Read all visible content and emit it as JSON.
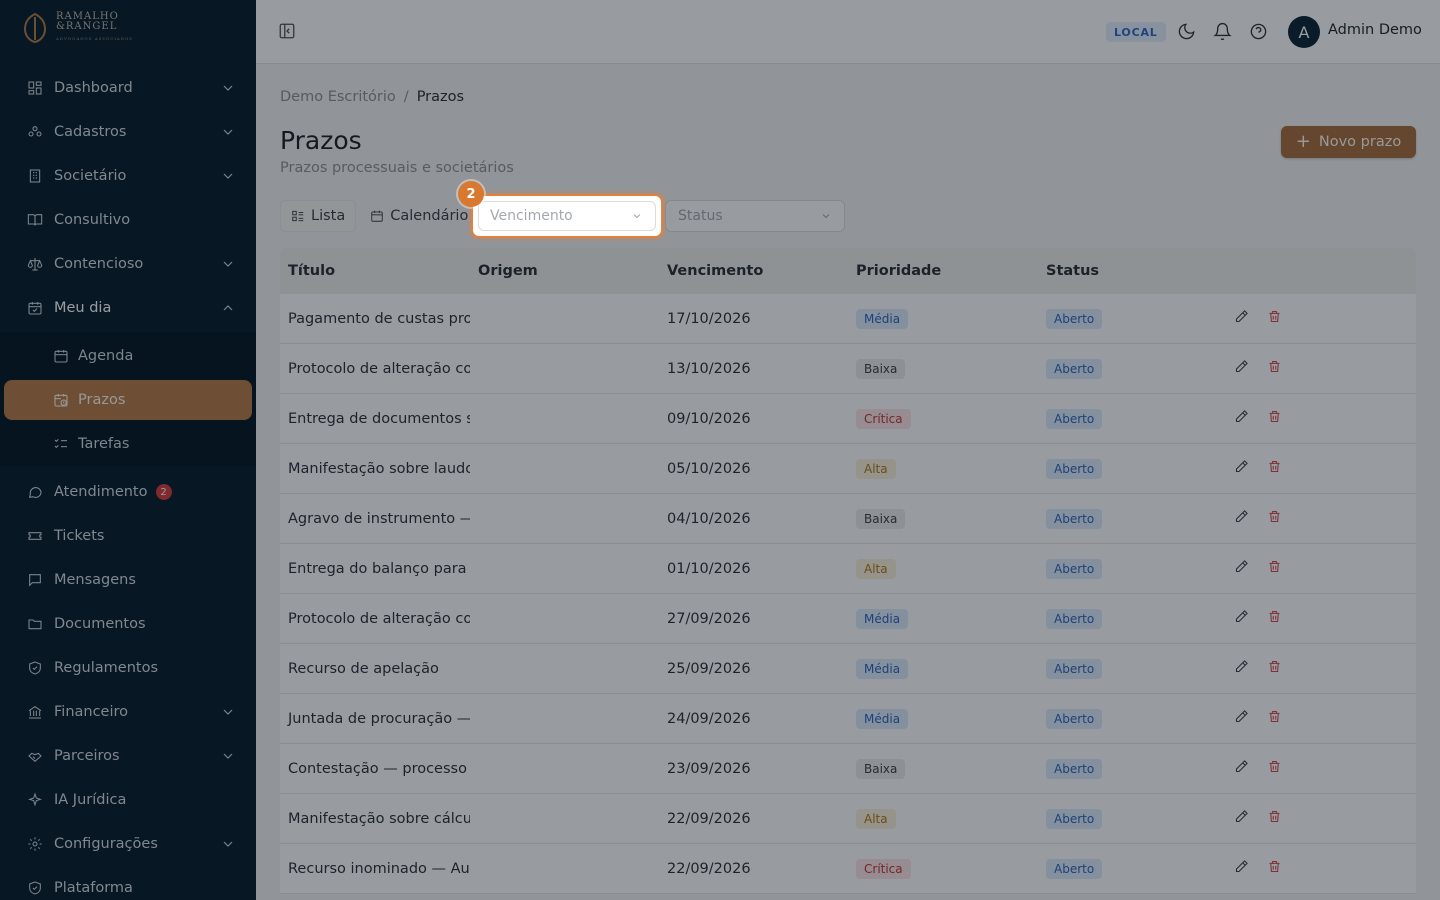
{
  "brand": {
    "line1": "RAMALHO",
    "line2": "&RANGEL",
    "tagline": "ADVOGADOS ASSOCIADOS"
  },
  "sidebar": {
    "items": [
      {
        "label": "Dashboard",
        "icon": "dashboard-icon",
        "chevron": "down"
      },
      {
        "label": "Cadastros",
        "icon": "users-icon",
        "chevron": "down"
      },
      {
        "label": "Societário",
        "icon": "building-icon",
        "chevron": "down"
      },
      {
        "label": "Consultivo",
        "icon": "book-icon"
      },
      {
        "label": "Contencioso",
        "icon": "scale-icon",
        "chevron": "down"
      },
      {
        "label": "Meu dia",
        "icon": "calendar-check-icon",
        "chevron": "up"
      },
      {
        "label": "Atendimento",
        "icon": "chat-icon",
        "badge": "2"
      },
      {
        "label": "Tickets",
        "icon": "ticket-icon"
      },
      {
        "label": "Mensagens",
        "icon": "message-icon"
      },
      {
        "label": "Documentos",
        "icon": "folder-icon"
      },
      {
        "label": "Regulamentos",
        "icon": "shield-icon"
      },
      {
        "label": "Financeiro",
        "icon": "bank-icon",
        "chevron": "down"
      },
      {
        "label": "Parceiros",
        "icon": "handshake-icon",
        "chevron": "down"
      },
      {
        "label": "IA Jurídica",
        "icon": "sparkles-icon"
      },
      {
        "label": "Configurações",
        "icon": "gear-icon",
        "chevron": "down"
      },
      {
        "label": "Plataforma",
        "icon": "shield-icon"
      }
    ],
    "submenu": [
      {
        "label": "Agenda",
        "icon": "calendar-icon"
      },
      {
        "label": "Prazos",
        "icon": "calendar-clock-icon",
        "active": true
      },
      {
        "label": "Tarefas",
        "icon": "list-checks-icon"
      }
    ]
  },
  "topbar": {
    "env": "LOCAL",
    "avatar_initial": "A",
    "user_name": "Admin Demo"
  },
  "breadcrumb": {
    "root": "Demo Escritório",
    "separator": "/",
    "current": "Prazos"
  },
  "page": {
    "title": "Prazos",
    "subtitle": "Prazos processuais e societários",
    "new_button": "Novo prazo"
  },
  "filters": {
    "view_tabs": [
      {
        "label": "Lista"
      },
      {
        "label": "Calendário"
      }
    ],
    "vencimento_placeholder": "Vencimento",
    "status_placeholder": "Status",
    "step_number": "2"
  },
  "table": {
    "columns": [
      "Título",
      "Origem",
      "Vencimento",
      "Prioridade",
      "Status"
    ],
    "rows": [
      {
        "title": "Pagamento de custas pro",
        "origem": "",
        "vencimento": "17/10/2026",
        "prioridade": "Média",
        "status": "Aberto"
      },
      {
        "title": "Protocolo de alteração co",
        "origem": "",
        "vencimento": "13/10/2026",
        "prioridade": "Baixa",
        "status": "Aberto"
      },
      {
        "title": "Entrega de documentos so",
        "origem": "",
        "vencimento": "09/10/2026",
        "prioridade": "Crítica",
        "status": "Aberto"
      },
      {
        "title": "Manifestação sobre laudo",
        "origem": "",
        "vencimento": "05/10/2026",
        "prioridade": "Alta",
        "status": "Aberto"
      },
      {
        "title": "Agravo de instrumento —",
        "origem": "",
        "vencimento": "04/10/2026",
        "prioridade": "Baixa",
        "status": "Aberto"
      },
      {
        "title": "Entrega do balanço para a",
        "origem": "",
        "vencimento": "01/10/2026",
        "prioridade": "Alta",
        "status": "Aberto"
      },
      {
        "title": "Protocolo de alteração co",
        "origem": "",
        "vencimento": "27/09/2026",
        "prioridade": "Média",
        "status": "Aberto"
      },
      {
        "title": "Recurso de apelação",
        "origem": "",
        "vencimento": "25/09/2026",
        "prioridade": "Média",
        "status": "Aberto"
      },
      {
        "title": "Juntada de procuração —",
        "origem": "",
        "vencimento": "24/09/2026",
        "prioridade": "Média",
        "status": "Aberto"
      },
      {
        "title": "Contestação — processo",
        "origem": "",
        "vencimento": "23/09/2026",
        "prioridade": "Baixa",
        "status": "Aberto"
      },
      {
        "title": "Manifestação sobre cálcu",
        "origem": "",
        "vencimento": "22/09/2026",
        "prioridade": "Alta",
        "status": "Aberto"
      },
      {
        "title": "Recurso inominado — Aur",
        "origem": "",
        "vencimento": "22/09/2026",
        "prioridade": "Crítica",
        "status": "Aberto"
      }
    ]
  },
  "colors": {
    "sidebar_bg": "#061a26",
    "accent": "#a86c3a",
    "highlight": "#e2803e",
    "priority": {
      "Média": {
        "bg": "#dfeafb",
        "fg": "#2c63b8"
      },
      "Baixa": {
        "bg": "#ecebe8",
        "fg": "#3d4146"
      },
      "Crítica": {
        "bg": "#fbe3e3",
        "fg": "#c23636"
      },
      "Alta": {
        "bg": "#fbf0d8",
        "fg": "#b07818"
      }
    },
    "status": {
      "Aberto": {
        "bg": "#dfeafb",
        "fg": "#2c63b8"
      }
    }
  }
}
